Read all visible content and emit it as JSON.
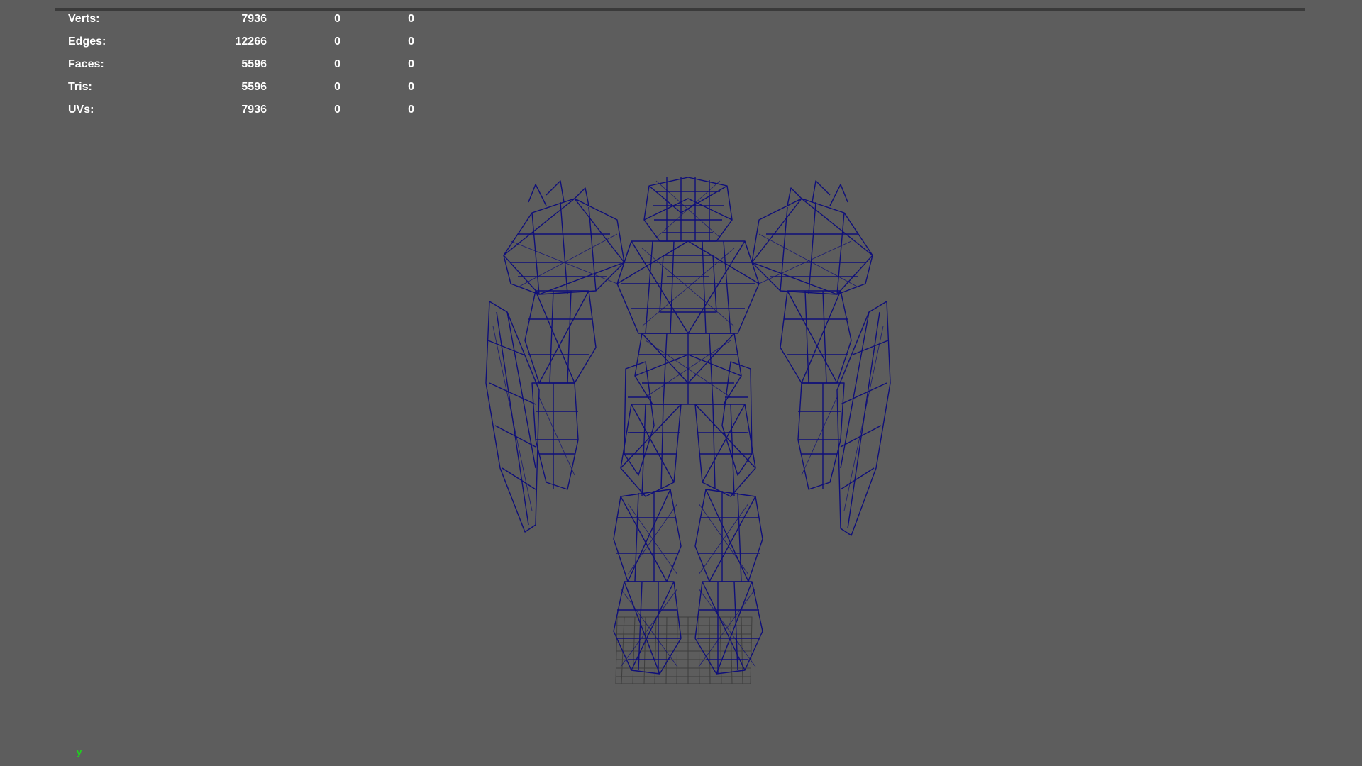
{
  "hud": {
    "rows": [
      {
        "label": "Verts:",
        "c1": "7936",
        "c2": "0",
        "c3": "0"
      },
      {
        "label": "Edges:",
        "c1": "12266",
        "c2": "0",
        "c3": "0"
      },
      {
        "label": "Faces:",
        "c1": "5596",
        "c2": "0",
        "c3": "0"
      },
      {
        "label": "Tris:",
        "c1": "5596",
        "c2": "0",
        "c3": "0"
      },
      {
        "label": "UVs:",
        "c1": "7936",
        "c2": "0",
        "c3": "0"
      }
    ]
  },
  "model": {
    "icon": "robot-wireframe",
    "wire_color": "#0f0f7a",
    "grid_color": "#3a3a3a"
  },
  "axis": {
    "label": "y",
    "color": "#1ed21e"
  },
  "colors": {
    "background": "#5d5d5d",
    "hud_text": "#ffffff"
  }
}
